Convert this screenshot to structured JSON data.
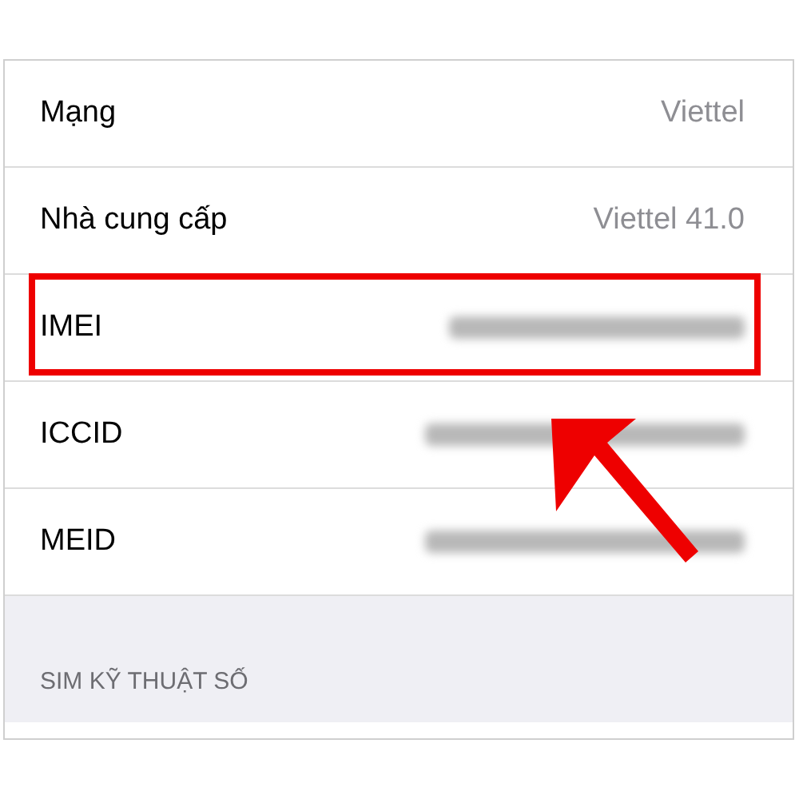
{
  "rows": [
    {
      "label": "Mạng",
      "kind": "text",
      "value": "Viettel",
      "highlighted": false
    },
    {
      "label": "Nhà cung cấp",
      "kind": "text",
      "value": "Viettel 41.0",
      "highlighted": false
    },
    {
      "label": "IMEI",
      "kind": "blurred",
      "highlighted": true
    },
    {
      "label": "ICCID",
      "kind": "blurred",
      "highlighted": false
    },
    {
      "label": "MEID",
      "kind": "blurred",
      "highlighted": false
    }
  ],
  "section_header": "SIM KỸ THUẬT SỐ"
}
